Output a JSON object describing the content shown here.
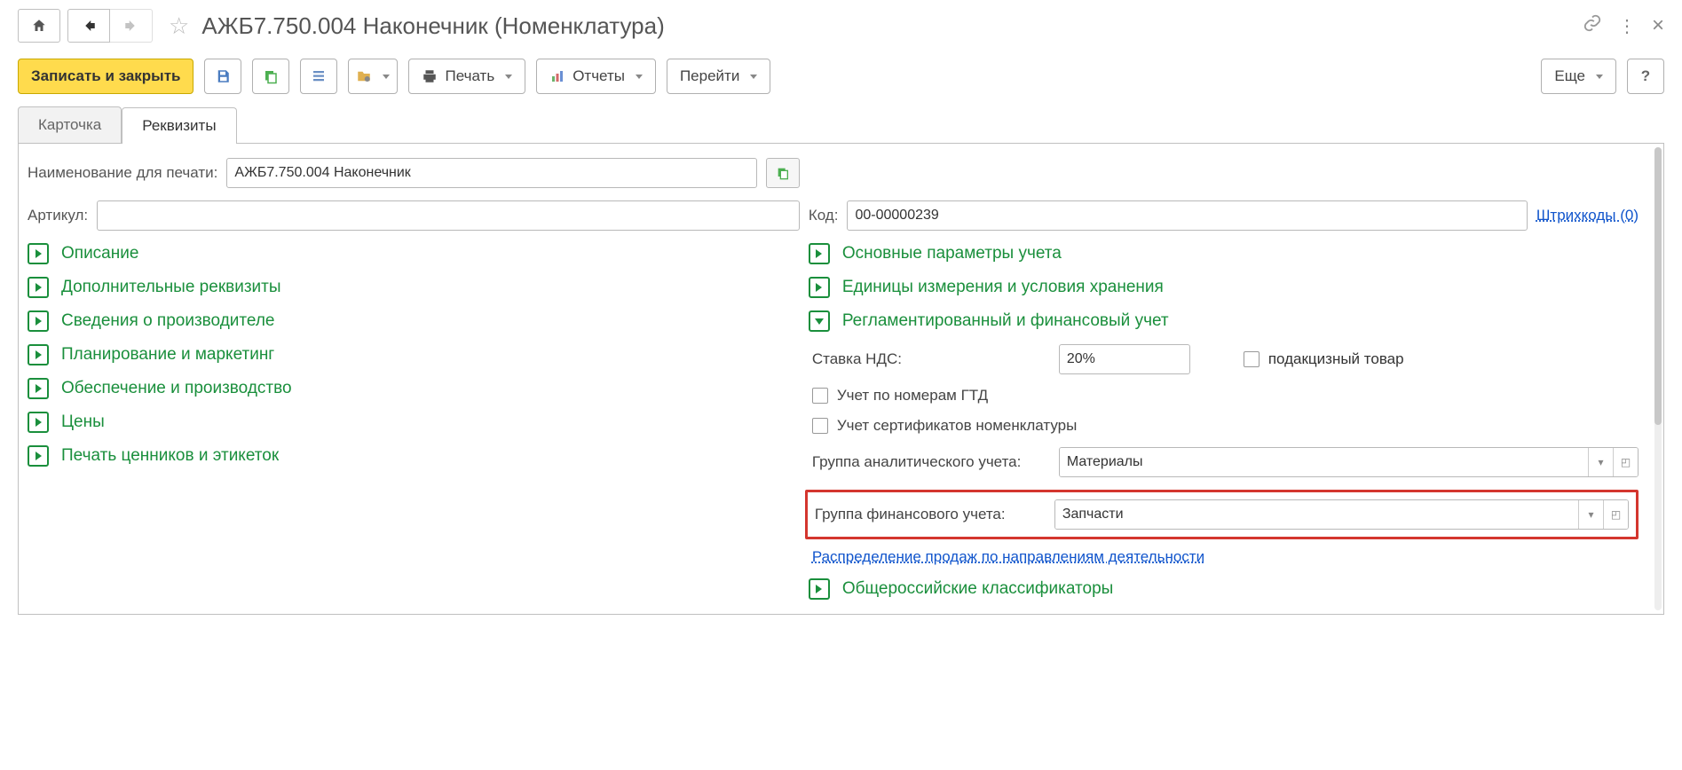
{
  "header": {
    "title": "АЖБ7.750.004 Наконечник (Номенклатура)"
  },
  "toolbar": {
    "save_close": "Записать и закрыть",
    "print": "Печать",
    "reports": "Отчеты",
    "goto": "Перейти",
    "more": "Еще",
    "help": "?"
  },
  "tabs": {
    "card": "Карточка",
    "requisites": "Реквизиты"
  },
  "fields": {
    "print_name_label": "Наименование для печати:",
    "print_name_value": "АЖБ7.750.004 Наконечник",
    "article_label": "Артикул:",
    "article_value": "",
    "code_label": "Код:",
    "code_value": "00-00000239",
    "barcodes_link": "Штрихкоды (0)"
  },
  "left_sections": {
    "s1": "Описание",
    "s2": "Дополнительные реквизиты",
    "s3": "Сведения о производителе",
    "s4": "Планирование и маркетинг",
    "s5": "Обеспечение и производство",
    "s6": "Цены",
    "s7": "Печать ценников и этикеток"
  },
  "right_sections": {
    "s1": "Основные параметры учета",
    "s2": "Единицы измерения и условия хранения",
    "s3": "Регламентированный и финансовый учет",
    "s4": "Общероссийские классификаторы"
  },
  "finance": {
    "vat_label": "Ставка НДС:",
    "vat_value": "20%",
    "excise_label": "подакцизный товар",
    "gtd_label": "Учет по номерам ГТД",
    "cert_label": "Учет сертификатов номенклатуры",
    "analytic_label": "Группа аналитического учета:",
    "analytic_value": "Материалы",
    "fin_label": "Группа финансового учета:",
    "fin_value": "Запчасти",
    "distribution_link": "Распределение продаж по направлениям деятельности"
  }
}
